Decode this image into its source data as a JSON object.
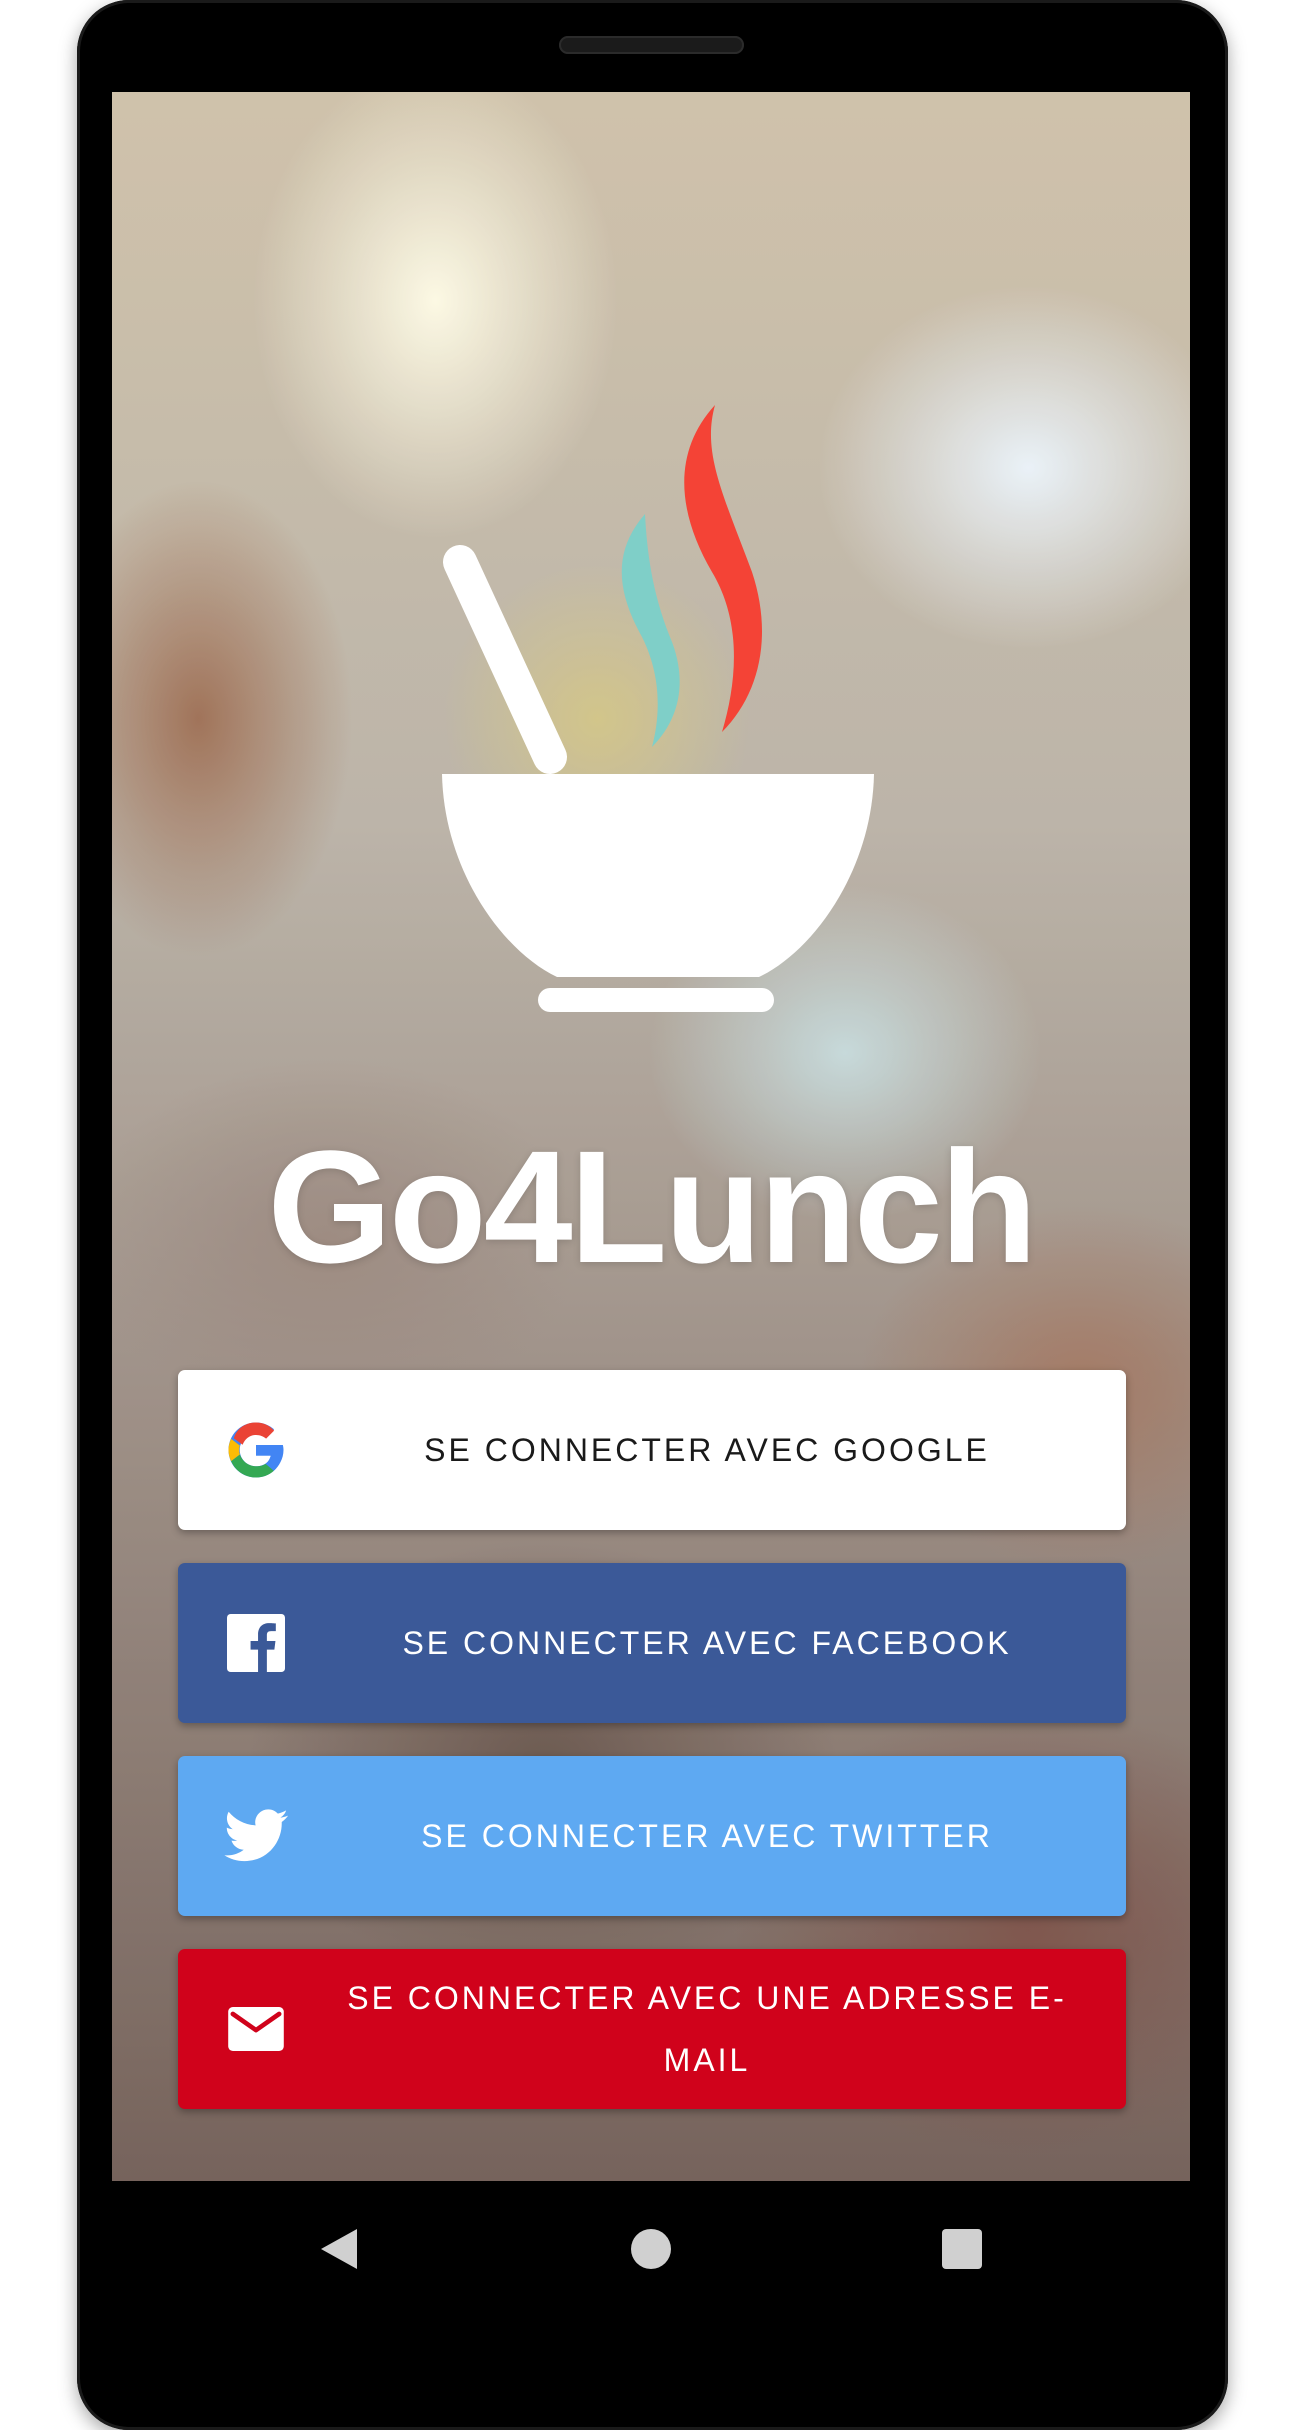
{
  "app": {
    "name": "Go4Lunch"
  },
  "logo": {
    "icon": "soup-bowl-icon",
    "steam_colors": [
      "#f44336",
      "#7fcfc8"
    ]
  },
  "login_buttons": [
    {
      "id": "google",
      "label": "SE CONNECTER AVEC GOOGLE",
      "icon": "google-icon",
      "bg": "#ffffff",
      "fg": "#1a1a1a"
    },
    {
      "id": "facebook",
      "label": "SE CONNECTER AVEC FACEBOOK",
      "icon": "facebook-icon",
      "bg": "#3b5998",
      "fg": "#ffffff"
    },
    {
      "id": "twitter",
      "label": "SE CONNECTER AVEC TWITTER",
      "icon": "twitter-icon",
      "bg": "#5ea9f2",
      "fg": "#ffffff"
    },
    {
      "id": "email",
      "label": "SE CONNECTER AVEC UNE ADRESSE E-MAIL",
      "icon": "mail-icon",
      "bg": "#d0021b",
      "fg": "#ffffff"
    }
  ],
  "navbar": {
    "buttons": [
      "back-icon",
      "home-icon",
      "recents-icon"
    ]
  }
}
